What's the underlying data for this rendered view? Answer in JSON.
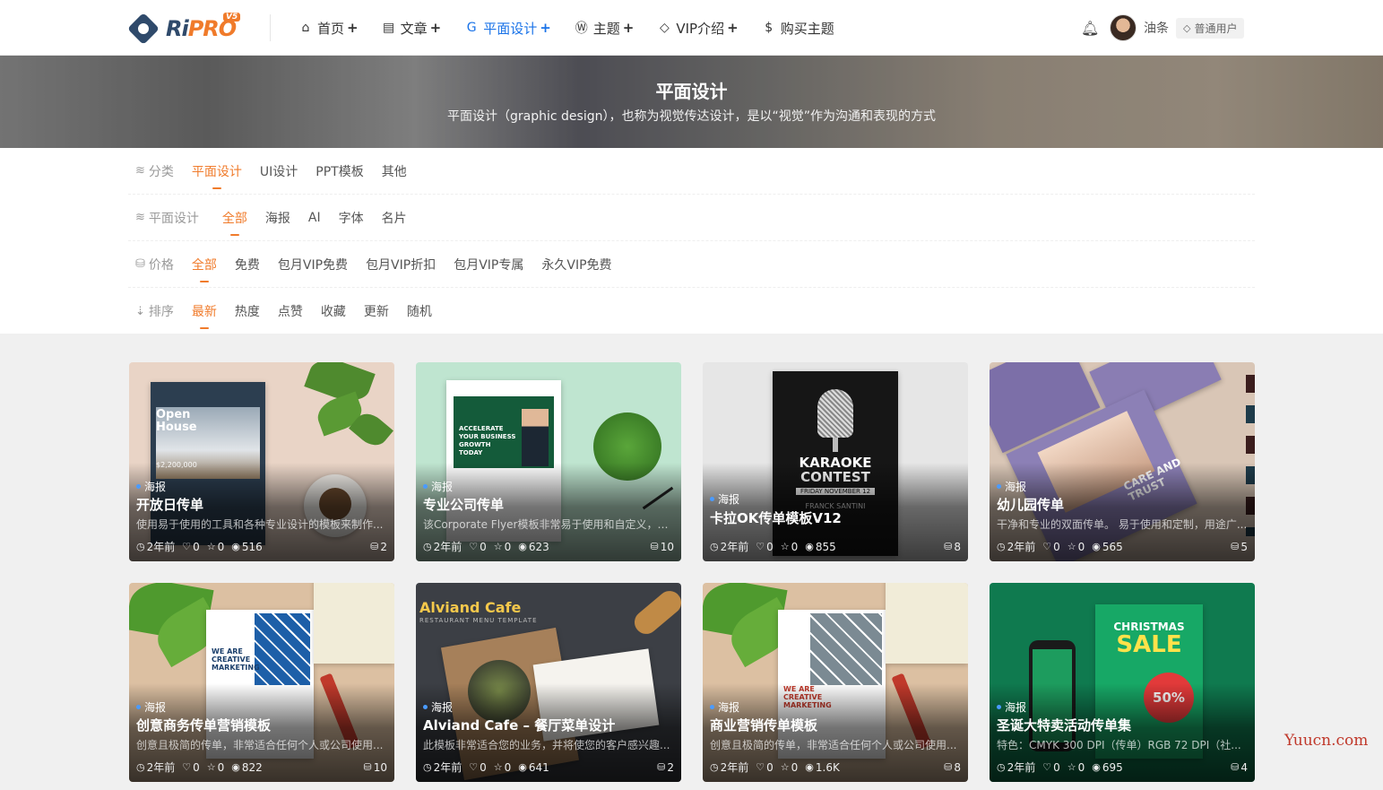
{
  "logo": {
    "brand_ri": "Ri",
    "brand_pro": "PRO",
    "version": "V5"
  },
  "nav": [
    {
      "label": "首页",
      "icon": "home-icon",
      "glyph": "⌂",
      "plus": "+"
    },
    {
      "label": "文章",
      "icon": "document-icon",
      "glyph": "▤",
      "plus": "+"
    },
    {
      "label": "平面设计",
      "icon": "design-icon",
      "glyph": "G",
      "plus": "+"
    },
    {
      "label": "主题",
      "icon": "wordpress-icon",
      "glyph": "Ⓦ",
      "plus": "+"
    },
    {
      "label": "VIP介绍",
      "icon": "diamond-icon",
      "glyph": "◇",
      "plus": "+"
    },
    {
      "label": "购买主题",
      "icon": "shopping-bag-icon",
      "glyph": "$",
      "plus": ""
    }
  ],
  "user": {
    "name": "油条",
    "badge": "普通用户"
  },
  "banner": {
    "title": "平面设计",
    "subtitle": "平面设计（graphic design），也称为视觉传达设计，是以“视觉”作为沟通和表现的方式"
  },
  "filters": [
    {
      "label": "分类",
      "icon": "layers-icon",
      "items": [
        "平面设计",
        "UI设计",
        "PPT模板",
        "其他"
      ],
      "active": 0
    },
    {
      "label": "平面设计",
      "icon": "layers-icon",
      "items": [
        "全部",
        "海报",
        "AI",
        "字体",
        "名片"
      ],
      "active": 0
    },
    {
      "label": "价格",
      "icon": "coins-icon",
      "items": [
        "全部",
        "免费",
        "包月VIP免费",
        "包月VIP折扣",
        "包月VIP专属",
        "永久VIP免费"
      ],
      "active": 0
    },
    {
      "label": "排序",
      "icon": "sort-icon",
      "items": [
        "最新",
        "热度",
        "点赞",
        "收藏",
        "更新",
        "随机"
      ],
      "active": 0
    }
  ],
  "cards": [
    {
      "tag": "海报",
      "title": "开放日传单",
      "desc": "使用易于使用的工具和各种专业设计的模板来制作...",
      "time": "2年前",
      "likes": "0",
      "stars": "0",
      "views": "516",
      "count": "2",
      "bg": "#e9d4c6"
    },
    {
      "tag": "海报",
      "title": "专业公司传单",
      "desc": "该Corporate Flyer模板非常易于使用和自定义，可...",
      "time": "2年前",
      "likes": "0",
      "stars": "0",
      "views": "623",
      "count": "10",
      "bg": "#bfe5d0"
    },
    {
      "tag": "海报",
      "title": "卡拉OK传单模板V12",
      "desc": "",
      "time": "2年前",
      "likes": "0",
      "stars": "0",
      "views": "855",
      "count": "8",
      "bg": "#e6e6e6"
    },
    {
      "tag": "海报",
      "title": "幼儿园传单",
      "desc": "干净和专业的双面传单。 易于使用和定制，用途广...",
      "time": "2年前",
      "likes": "0",
      "stars": "0",
      "views": "565",
      "count": "5",
      "bg": "#d9c6b6"
    },
    {
      "tag": "海报",
      "title": "创意商务传单营销模板",
      "desc": "创意且极简的传单，非常适合任何个人或公司使用...",
      "time": "2年前",
      "likes": "0",
      "stars": "0",
      "views": "822",
      "count": "10",
      "bg": "#dcc0a2"
    },
    {
      "tag": "海报",
      "title": "Alviand Cafe – 餐厅菜单设计",
      "desc": "此模板非常适合您的业务，并将使您的客户感兴趣...",
      "time": "2年前",
      "likes": "0",
      "stars": "0",
      "views": "641",
      "count": "2",
      "bg": "#3c3f45"
    },
    {
      "tag": "海报",
      "title": "商业营销传单模板",
      "desc": "创意且极简的传单，非常适合任何个人或公司使用...",
      "time": "2年前",
      "likes": "0",
      "stars": "0",
      "views": "1.6K",
      "count": "8",
      "bg": "#dcc0a2"
    },
    {
      "tag": "海报",
      "title": "圣诞大特卖活动传单集",
      "desc": "特色：CMYK 300 DPI（传单）RGB 72 DPI（社...",
      "time": "2年前",
      "likes": "0",
      "stars": "0",
      "views": "695",
      "count": "4",
      "bg": "#0f7a4f"
    }
  ],
  "art_text": {
    "open_house": "Open House",
    "price": "$2,200,000",
    "accelerate": "ACCELERATE YOUR BUSINESS GROWTH TODAY",
    "karaoke": "KARAOKE CONTEST",
    "karaoke_date": "FRIDAY NOVEMBER 12",
    "karaoke_name": "FRANCK SANTINI",
    "care": "CARE AND TRUST",
    "creative": "WE ARE CREATIVE MARKETING",
    "cafe_name": "Alviand Cafe",
    "cafe_sub": "RESTAURANT MENU TEMPLATE",
    "christmas": "CHRISTMAS",
    "sale": "SALE",
    "off": "50%"
  },
  "watermark": "Yuucn.com",
  "colors": {
    "accent": "#f07b2b",
    "nav_active": "#1a73e8",
    "tag_dot": "#4a9bff"
  }
}
